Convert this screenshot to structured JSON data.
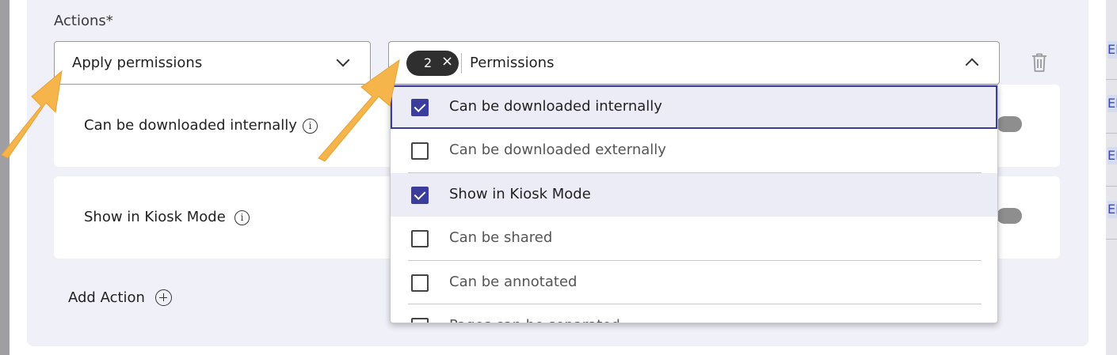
{
  "actions_label": "Actions*",
  "action_select": {
    "value": "Apply permissions"
  },
  "permissions_select": {
    "chip_count": "2",
    "chip_remove_glyph": "×",
    "placeholder": "Permissions"
  },
  "cards": [
    {
      "label": "Can be downloaded internally",
      "toggle_on": false
    },
    {
      "label": "Show in Kiosk Mode",
      "toggle_on": false
    }
  ],
  "add_action_label": "Add Action",
  "dropdown": {
    "options": [
      {
        "label": "Can be downloaded internally",
        "checked": true,
        "focused": true
      },
      {
        "label": "Can be downloaded externally",
        "checked": false
      },
      {
        "label": "Show in Kiosk Mode",
        "checked": true
      },
      {
        "label": "Can be shared",
        "checked": false
      },
      {
        "label": "Can be annotated",
        "checked": false
      },
      {
        "label": "Pages can be separated",
        "checked": false
      }
    ]
  },
  "right_edge_tags": [
    "ED",
    "ED",
    "ED",
    "ED"
  ],
  "colors": {
    "accent": "#3a3d9c",
    "panel_bg": "#f0f0f8",
    "arrow": "#f5b54a",
    "chip": "#2f2f2f"
  },
  "icons": [
    "chevron-down-icon",
    "chevron-up-icon",
    "close-icon",
    "trash-icon",
    "info-icon",
    "add-circle-icon",
    "checkbox-icon"
  ]
}
